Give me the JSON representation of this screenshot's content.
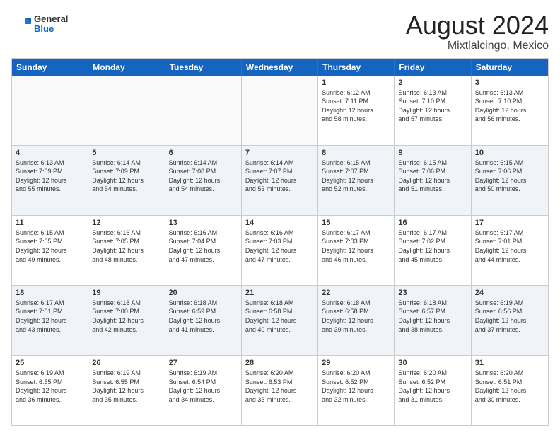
{
  "header": {
    "logo": {
      "general": "General",
      "blue": "Blue"
    },
    "title": "August 2024",
    "location": "Mixtlalcingo, Mexico"
  },
  "weekdays": [
    "Sunday",
    "Monday",
    "Tuesday",
    "Wednesday",
    "Thursday",
    "Friday",
    "Saturday"
  ],
  "weeks": [
    [
      {
        "day": "",
        "info": ""
      },
      {
        "day": "",
        "info": ""
      },
      {
        "day": "",
        "info": ""
      },
      {
        "day": "",
        "info": ""
      },
      {
        "day": "1",
        "info": "Sunrise: 6:12 AM\nSunset: 7:11 PM\nDaylight: 12 hours\nand 58 minutes."
      },
      {
        "day": "2",
        "info": "Sunrise: 6:13 AM\nSunset: 7:10 PM\nDaylight: 12 hours\nand 57 minutes."
      },
      {
        "day": "3",
        "info": "Sunrise: 6:13 AM\nSunset: 7:10 PM\nDaylight: 12 hours\nand 56 minutes."
      }
    ],
    [
      {
        "day": "4",
        "info": "Sunrise: 6:13 AM\nSunset: 7:09 PM\nDaylight: 12 hours\nand 55 minutes."
      },
      {
        "day": "5",
        "info": "Sunrise: 6:14 AM\nSunset: 7:09 PM\nDaylight: 12 hours\nand 54 minutes."
      },
      {
        "day": "6",
        "info": "Sunrise: 6:14 AM\nSunset: 7:08 PM\nDaylight: 12 hours\nand 54 minutes."
      },
      {
        "day": "7",
        "info": "Sunrise: 6:14 AM\nSunset: 7:07 PM\nDaylight: 12 hours\nand 53 minutes."
      },
      {
        "day": "8",
        "info": "Sunrise: 6:15 AM\nSunset: 7:07 PM\nDaylight: 12 hours\nand 52 minutes."
      },
      {
        "day": "9",
        "info": "Sunrise: 6:15 AM\nSunset: 7:06 PM\nDaylight: 12 hours\nand 51 minutes."
      },
      {
        "day": "10",
        "info": "Sunrise: 6:15 AM\nSunset: 7:06 PM\nDaylight: 12 hours\nand 50 minutes."
      }
    ],
    [
      {
        "day": "11",
        "info": "Sunrise: 6:15 AM\nSunset: 7:05 PM\nDaylight: 12 hours\nand 49 minutes."
      },
      {
        "day": "12",
        "info": "Sunrise: 6:16 AM\nSunset: 7:05 PM\nDaylight: 12 hours\nand 48 minutes."
      },
      {
        "day": "13",
        "info": "Sunrise: 6:16 AM\nSunset: 7:04 PM\nDaylight: 12 hours\nand 47 minutes."
      },
      {
        "day": "14",
        "info": "Sunrise: 6:16 AM\nSunset: 7:03 PM\nDaylight: 12 hours\nand 47 minutes."
      },
      {
        "day": "15",
        "info": "Sunrise: 6:17 AM\nSunset: 7:03 PM\nDaylight: 12 hours\nand 46 minutes."
      },
      {
        "day": "16",
        "info": "Sunrise: 6:17 AM\nSunset: 7:02 PM\nDaylight: 12 hours\nand 45 minutes."
      },
      {
        "day": "17",
        "info": "Sunrise: 6:17 AM\nSunset: 7:01 PM\nDaylight: 12 hours\nand 44 minutes."
      }
    ],
    [
      {
        "day": "18",
        "info": "Sunrise: 6:17 AM\nSunset: 7:01 PM\nDaylight: 12 hours\nand 43 minutes."
      },
      {
        "day": "19",
        "info": "Sunrise: 6:18 AM\nSunset: 7:00 PM\nDaylight: 12 hours\nand 42 minutes."
      },
      {
        "day": "20",
        "info": "Sunrise: 6:18 AM\nSunset: 6:59 PM\nDaylight: 12 hours\nand 41 minutes."
      },
      {
        "day": "21",
        "info": "Sunrise: 6:18 AM\nSunset: 6:58 PM\nDaylight: 12 hours\nand 40 minutes."
      },
      {
        "day": "22",
        "info": "Sunrise: 6:18 AM\nSunset: 6:58 PM\nDaylight: 12 hours\nand 39 minutes."
      },
      {
        "day": "23",
        "info": "Sunrise: 6:18 AM\nSunset: 6:57 PM\nDaylight: 12 hours\nand 38 minutes."
      },
      {
        "day": "24",
        "info": "Sunrise: 6:19 AM\nSunset: 6:56 PM\nDaylight: 12 hours\nand 37 minutes."
      }
    ],
    [
      {
        "day": "25",
        "info": "Sunrise: 6:19 AM\nSunset: 6:55 PM\nDaylight: 12 hours\nand 36 minutes."
      },
      {
        "day": "26",
        "info": "Sunrise: 6:19 AM\nSunset: 6:55 PM\nDaylight: 12 hours\nand 35 minutes."
      },
      {
        "day": "27",
        "info": "Sunrise: 6:19 AM\nSunset: 6:54 PM\nDaylight: 12 hours\nand 34 minutes."
      },
      {
        "day": "28",
        "info": "Sunrise: 6:20 AM\nSunset: 6:53 PM\nDaylight: 12 hours\nand 33 minutes."
      },
      {
        "day": "29",
        "info": "Sunrise: 6:20 AM\nSunset: 6:52 PM\nDaylight: 12 hours\nand 32 minutes."
      },
      {
        "day": "30",
        "info": "Sunrise: 6:20 AM\nSunset: 6:52 PM\nDaylight: 12 hours\nand 31 minutes."
      },
      {
        "day": "31",
        "info": "Sunrise: 6:20 AM\nSunset: 6:51 PM\nDaylight: 12 hours\nand 30 minutes."
      }
    ]
  ]
}
